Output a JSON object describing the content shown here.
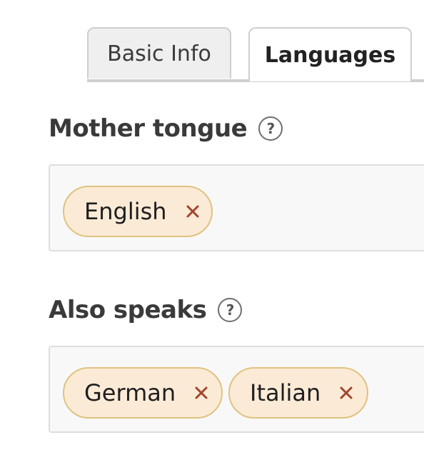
{
  "tabs": [
    {
      "label": "Basic Info",
      "active": false
    },
    {
      "label": "Languages",
      "active": true
    }
  ],
  "mother_tongue": {
    "label": "Mother tongue",
    "help_icon": "question-circle-icon",
    "tokens": [
      {
        "label": "English",
        "remove_icon": "close-x-icon"
      }
    ]
  },
  "also_speaks": {
    "label": "Also speaks",
    "help_icon": "question-circle-icon",
    "tokens": [
      {
        "label": "German",
        "remove_icon": "close-x-icon"
      },
      {
        "label": "Italian",
        "remove_icon": "close-x-icon"
      }
    ]
  },
  "colors": {
    "token_bg": "#fbebd6",
    "token_border": "#e1c280",
    "remove_x": "#a3442f",
    "field_bg": "#f8f8f8"
  }
}
